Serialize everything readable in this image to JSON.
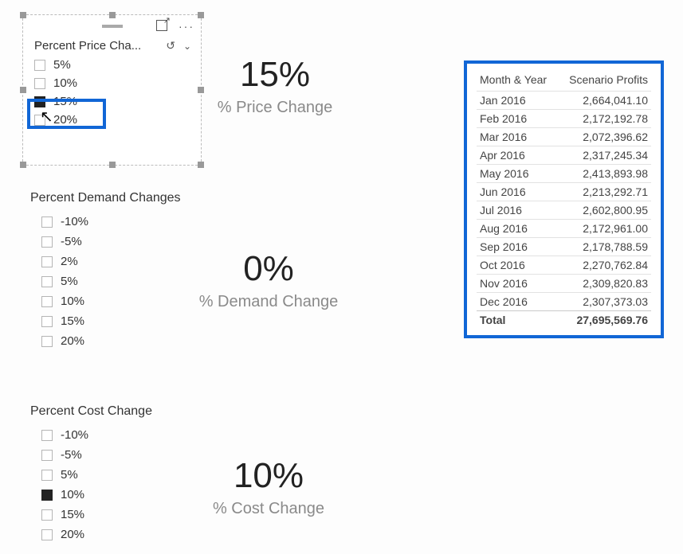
{
  "slicers": {
    "price": {
      "title": "Percent Price Cha...",
      "items": [
        {
          "label": "5%",
          "checked": false
        },
        {
          "label": "10%",
          "checked": false
        },
        {
          "label": "15%",
          "checked": true
        },
        {
          "label": "20%",
          "checked": false
        }
      ]
    },
    "demand": {
      "title": "Percent Demand Changes",
      "items": [
        {
          "label": "-10%",
          "checked": false
        },
        {
          "label": "-5%",
          "checked": false
        },
        {
          "label": "2%",
          "checked": false
        },
        {
          "label": "5%",
          "checked": false
        },
        {
          "label": "10%",
          "checked": false
        },
        {
          "label": "15%",
          "checked": false
        },
        {
          "label": "20%",
          "checked": false
        }
      ]
    },
    "cost": {
      "title": "Percent Cost Change",
      "items": [
        {
          "label": "-10%",
          "checked": false
        },
        {
          "label": "-5%",
          "checked": false
        },
        {
          "label": "5%",
          "checked": false
        },
        {
          "label": "10%",
          "checked": true
        },
        {
          "label": "15%",
          "checked": false
        },
        {
          "label": "20%",
          "checked": false
        }
      ]
    }
  },
  "cards": {
    "price": {
      "value": "15%",
      "label": "% Price Change"
    },
    "demand": {
      "value": "0%",
      "label": "% Demand Change"
    },
    "cost": {
      "value": "10%",
      "label": "% Cost Change"
    }
  },
  "table": {
    "headers": {
      "month": "Month & Year",
      "profit": "Scenario Profits"
    },
    "rows": [
      {
        "month": "Jan 2016",
        "profit": "2,664,041.10"
      },
      {
        "month": "Feb 2016",
        "profit": "2,172,192.78"
      },
      {
        "month": "Mar 2016",
        "profit": "2,072,396.62"
      },
      {
        "month": "Apr 2016",
        "profit": "2,317,245.34"
      },
      {
        "month": "May 2016",
        "profit": "2,413,893.98"
      },
      {
        "month": "Jun 2016",
        "profit": "2,213,292.71"
      },
      {
        "month": "Jul 2016",
        "profit": "2,602,800.95"
      },
      {
        "month": "Aug 2016",
        "profit": "2,172,961.00"
      },
      {
        "month": "Sep 2016",
        "profit": "2,178,788.59"
      },
      {
        "month": "Oct 2016",
        "profit": "2,270,762.84"
      },
      {
        "month": "Nov 2016",
        "profit": "2,309,820.83"
      },
      {
        "month": "Dec 2016",
        "profit": "2,307,373.03"
      }
    ],
    "total": {
      "label": "Total",
      "profit": "27,695,569.76"
    }
  },
  "icons": {
    "more": "···"
  }
}
